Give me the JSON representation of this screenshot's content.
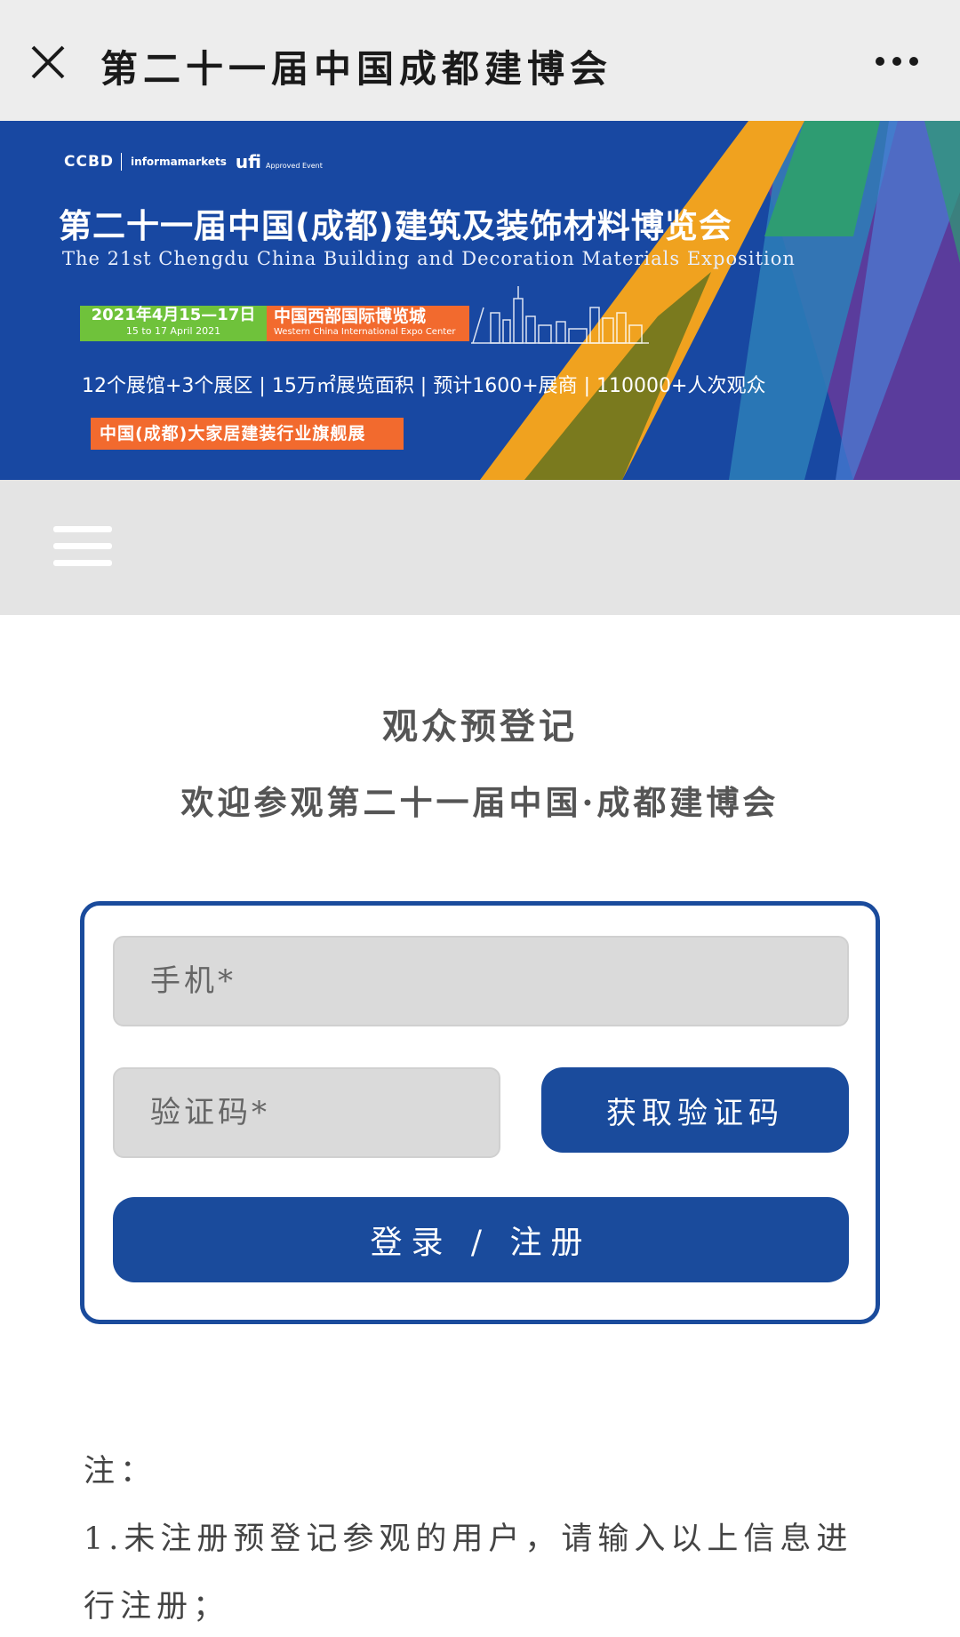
{
  "window": {
    "title": "第二十一届中国成都建博会"
  },
  "banner": {
    "logo_ccbd": "CCBD",
    "logo_informa": "informamarkets",
    "logo_ufi": "ufi",
    "logo_ufi_sub": "Approved Event",
    "title": "第二十一届中国(成都)建筑及装饰材料博览会",
    "subtitle": "The 21st Chengdu China Building and Decoration Materials Exposition",
    "date_main": "2021年4月15—17日",
    "date_sub": "15 to 17 April 2021",
    "venue_main": "中国西部国际博览城",
    "venue_sub": "Western China International Expo Center",
    "stats": "12个展馆+3个展区 | 15万㎡展览面积 | 预计1600+展商 | 110000+人次观众",
    "tag": "中国(成都)大家居建装行业旗舰展",
    "colors": {
      "blue": "#1848a2",
      "orange": "#f0a21f",
      "green": "#2e9c72",
      "purple": "#5a3c9c",
      "olive": "#7a7a1e"
    }
  },
  "page": {
    "heading": "观众预登记",
    "subheading": "欢迎参观第二十一届中国·成都建博会"
  },
  "form": {
    "phone_placeholder": "手机*",
    "code_placeholder": "验证码*",
    "get_code_label": "获取验证码",
    "login_label": "登录 / 注册"
  },
  "notes": {
    "label": "注：",
    "item1": "1.未注册预登记参观的用户，请输入以上信息进行注册；"
  },
  "icons": {
    "close": "close-icon",
    "more": "more-icon",
    "menu": "hamburger-menu-icon"
  }
}
